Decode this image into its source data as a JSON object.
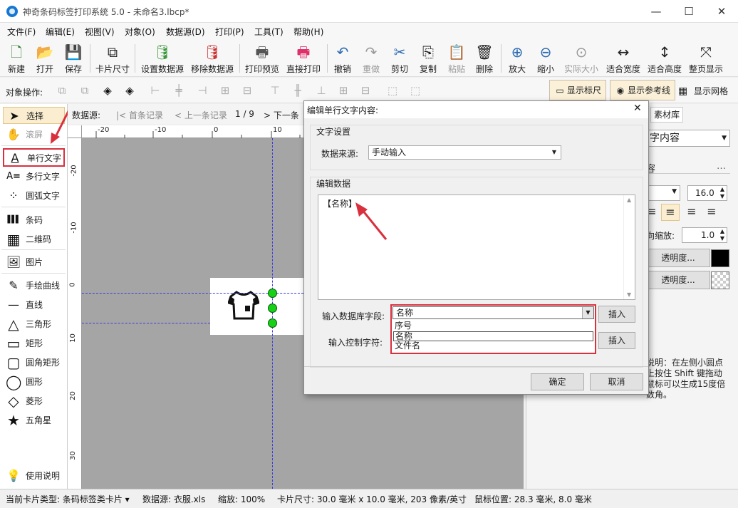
{
  "app": {
    "title": "神奇条码标签打印系统 5.0 - 未命名3.lbcp*",
    "min": "—",
    "max": "☐",
    "close": "✕"
  },
  "menu": [
    "文件(F)",
    "编辑(E)",
    "视图(V)",
    "对象(O)",
    "数据源(D)",
    "打印(P)",
    "工具(T)",
    "帮助(H)"
  ],
  "toolbar": [
    {
      "label": "新建",
      "icon": "new-file-icon",
      "glyph": "🗋"
    },
    {
      "label": "打开",
      "icon": "open-icon",
      "glyph": "📂"
    },
    {
      "label": "保存",
      "icon": "save-icon",
      "glyph": "💾"
    },
    {
      "label": "卡片尺寸",
      "icon": "card-size-icon",
      "glyph": "⧉"
    },
    {
      "label": "设置数据源",
      "icon": "set-datasource-icon",
      "glyph": "🛢"
    },
    {
      "label": "移除数据源",
      "icon": "remove-datasource-icon",
      "glyph": "🛢"
    },
    {
      "label": "打印预览",
      "icon": "print-preview-icon",
      "glyph": "🖶"
    },
    {
      "label": "直接打印",
      "icon": "print-icon",
      "glyph": "🖶"
    },
    {
      "label": "撤销",
      "icon": "undo-icon",
      "glyph": "↶"
    },
    {
      "label": "重做",
      "icon": "redo-icon",
      "glyph": "↷"
    },
    {
      "label": "剪切",
      "icon": "cut-icon",
      "glyph": "✂"
    },
    {
      "label": "复制",
      "icon": "copy-icon",
      "glyph": "⎘"
    },
    {
      "label": "粘贴",
      "icon": "paste-icon",
      "glyph": "📋"
    },
    {
      "label": "删除",
      "icon": "delete-icon",
      "glyph": "🗑"
    },
    {
      "label": "放大",
      "icon": "zoom-in-icon",
      "glyph": "⊕"
    },
    {
      "label": "缩小",
      "icon": "zoom-out-icon",
      "glyph": "⊖"
    },
    {
      "label": "实际大小",
      "icon": "actual-size-icon",
      "glyph": "⊙"
    },
    {
      "label": "适合宽度",
      "icon": "fit-width-icon",
      "glyph": "↔"
    },
    {
      "label": "适合高度",
      "icon": "fit-height-icon",
      "glyph": "↕"
    },
    {
      "label": "整页显示",
      "icon": "fit-page-icon",
      "glyph": "⤧"
    }
  ],
  "toolbar2": {
    "label": "对象操作:",
    "show_ruler": "显示标尺",
    "show_guides": "显示参考线",
    "show_grid": "显示网格"
  },
  "left_tools": [
    {
      "label": "选择",
      "icon": "pointer-icon",
      "glyph": "➤"
    },
    {
      "label": "滚屏",
      "icon": "hand-icon",
      "glyph": "✋"
    },
    {
      "label": "单行文字",
      "icon": "single-line-text-icon",
      "glyph": "A"
    },
    {
      "label": "多行文字",
      "icon": "multi-line-text-icon",
      "glyph": "A≡"
    },
    {
      "label": "圆弧文字",
      "icon": "arc-text-icon",
      "glyph": "⁘"
    },
    {
      "label": "条码",
      "icon": "barcode-icon",
      "glyph": "▌▌▌"
    },
    {
      "label": "二维码",
      "icon": "qrcode-icon",
      "glyph": "▦"
    },
    {
      "label": "图片",
      "icon": "image-icon",
      "glyph": "🖼"
    },
    {
      "label": "手绘曲线",
      "icon": "freehand-icon",
      "glyph": "✎"
    },
    {
      "label": "直线",
      "icon": "line-icon",
      "glyph": "—"
    },
    {
      "label": "三角形",
      "icon": "triangle-icon",
      "glyph": "△"
    },
    {
      "label": "矩形",
      "icon": "rectangle-icon",
      "glyph": "▭"
    },
    {
      "label": "圆角矩形",
      "icon": "rounded-rect-icon",
      "glyph": "▢"
    },
    {
      "label": "圆形",
      "icon": "circle-icon",
      "glyph": "◯"
    },
    {
      "label": "菱形",
      "icon": "diamond-icon",
      "glyph": "◇"
    },
    {
      "label": "五角星",
      "icon": "star-icon",
      "glyph": "★"
    },
    {
      "label": "使用说明",
      "icon": "lightbulb-icon",
      "glyph": "💡"
    }
  ],
  "navbar": {
    "label": "数据源:",
    "first": "首条记录",
    "prev": "上一条记录",
    "page": "1 / 9",
    "next": "下一条"
  },
  "ruler": {
    "h": [
      "-20",
      "-10",
      "0",
      "10"
    ],
    "v": [
      "-20",
      "-10",
      "0",
      "10",
      "20",
      "30"
    ]
  },
  "right_panel": {
    "tab": "素材库",
    "content_combo": "字内容",
    "content_label": "容",
    "font_size": "16.0",
    "scale_label": "向缩放:",
    "scale_value": "1.0",
    "opacity1": "透明度...",
    "opacity2": "透明度...",
    "help_text": "说明：在左侧小圆点\n上按住 Shift 键拖动\n鼠标可以生成15度倍\n数角。"
  },
  "dialog": {
    "title": "编辑单行文字内容:",
    "group_text": "文字设置",
    "source_label": "数据来源:",
    "source_value": "手动输入",
    "group_edit": "编辑数据",
    "edit_content": "【名称】",
    "db_field_label": "输入数据库字段:",
    "db_field_value": "名称",
    "db_options": [
      "序号",
      "名称",
      "文件名"
    ],
    "insert1": "插入",
    "control_label": "输入控制字符:",
    "insert2": "插入",
    "ok": "确定",
    "cancel": "取消"
  },
  "status": {
    "card_type": "当前卡片类型: 条码标签类卡片 ▾",
    "datasource": "数据源: 衣服.xls",
    "zoom": "缩放: 100%",
    "card_size": "卡片尺寸: 30.0 毫米 x 10.0 毫米, 203 像素/英寸",
    "mouse": "鼠标位置: 28.3 毫米, 8.0 毫米"
  },
  "colors": {
    "accent": "#d9303e",
    "select_bg": "#fbeed0",
    "guide": "#3a3adf",
    "handle": "#17d117"
  }
}
